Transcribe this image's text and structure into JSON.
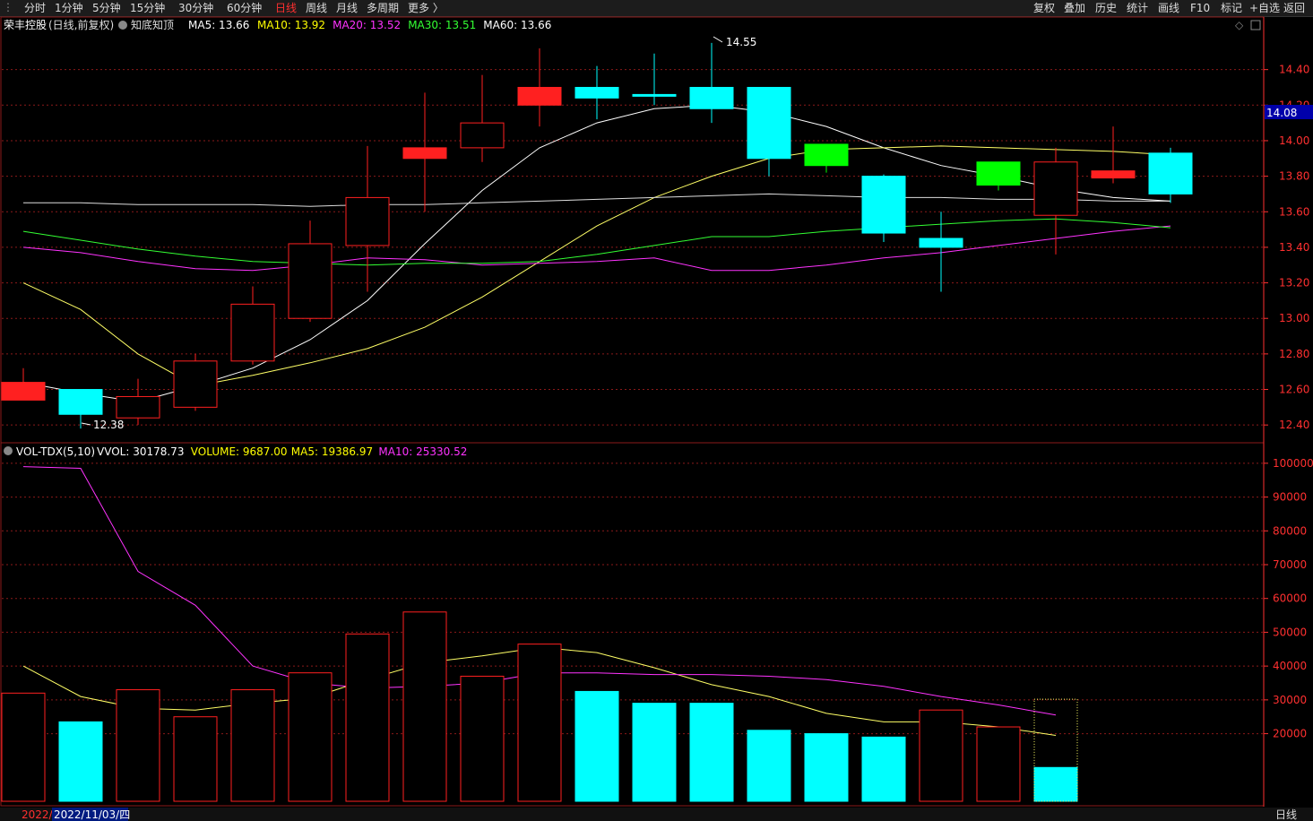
{
  "toolbar": {
    "left": [
      "分时",
      "1分钟",
      "5分钟",
      "15分钟",
      "30分钟",
      "60分钟",
      "日线",
      "周线",
      "月线",
      "多周期",
      "更多 〉"
    ],
    "active": "日线",
    "right": [
      "复权",
      "叠加",
      "历史",
      "统计",
      "画线",
      "F10",
      "标记",
      "+自选",
      "返回"
    ]
  },
  "colors": {
    "up": "#ff2020",
    "down": "#00ffff",
    "bear": "#00ff00",
    "ma5": "#ffffff",
    "ma10": "#ffff66",
    "ma20": "#ff33ff",
    "ma30": "#33ff33",
    "ma60": "#ffffff",
    "grid": "#8b1a1a",
    "axis": "#ff3030"
  },
  "price_panel": {
    "stock": "荣丰控股",
    "mode": "(日线,前复权)",
    "indicator": "知底知顶",
    "ma_labels": [
      {
        "text": "MA5: 13.66",
        "color": "#ffffff"
      },
      {
        "text": "MA10: 13.92",
        "color": "#ffff00"
      },
      {
        "text": "MA20: 13.52",
        "color": "#ff33ff"
      },
      {
        "text": "MA30: 13.51",
        "color": "#33ff33"
      },
      {
        "text": "MA60: 13.66",
        "color": "#ffffff"
      }
    ],
    "current_price": "14.08",
    "max_label": "14.55",
    "min_label": "12.38"
  },
  "volume_panel": {
    "title": "VOL-TDX(5,10)",
    "labels": [
      {
        "text": "VVOL: 30178.73",
        "color": "#ffffff"
      },
      {
        "text": "VOLUME: 9687.00",
        "color": "#ffff00"
      },
      {
        "text": "MA5: 19386.97",
        "color": "#ffff00"
      },
      {
        "text": "MA10: 25330.52",
        "color": "#ff33ff"
      }
    ]
  },
  "footer": {
    "date_prefix": "2022/",
    "date_selected": "2022/11/03/四",
    "period": "日线"
  },
  "chart_data": [
    {
      "type": "candlestick",
      "ylim": [
        12.3,
        14.6
      ],
      "yticks": [
        12.4,
        12.6,
        12.8,
        13.0,
        13.2,
        13.4,
        13.6,
        13.8,
        14.0,
        14.2,
        14.4
      ],
      "candles": [
        {
          "o": 12.64,
          "h": 12.72,
          "l": 12.54,
          "c": 12.54,
          "color": "up"
        },
        {
          "o": 12.6,
          "h": 12.6,
          "l": 12.38,
          "c": 12.46,
          "color": "down"
        },
        {
          "o": 12.56,
          "h": 12.66,
          "l": 12.4,
          "c": 12.44,
          "color": "up"
        },
        {
          "o": 12.5,
          "h": 12.8,
          "l": 12.48,
          "c": 12.76,
          "color": "up"
        },
        {
          "o": 12.76,
          "h": 13.18,
          "l": 12.74,
          "c": 13.08,
          "color": "up"
        },
        {
          "o": 13.0,
          "h": 13.55,
          "l": 12.98,
          "c": 13.42,
          "color": "up"
        },
        {
          "o": 13.41,
          "h": 13.97,
          "l": 13.15,
          "c": 13.68,
          "color": "up"
        },
        {
          "o": 13.9,
          "h": 14.27,
          "l": 13.6,
          "c": 13.96,
          "color": "up"
        },
        {
          "o": 13.96,
          "h": 14.37,
          "l": 13.88,
          "c": 14.1,
          "color": "up"
        },
        {
          "o": 14.2,
          "h": 14.52,
          "l": 14.08,
          "c": 14.3,
          "color": "up"
        },
        {
          "o": 14.3,
          "h": 14.42,
          "l": 14.12,
          "c": 14.24,
          "color": "down"
        },
        {
          "o": 14.26,
          "h": 14.49,
          "l": 14.2,
          "c": 14.26,
          "color": "down"
        },
        {
          "o": 14.3,
          "h": 14.55,
          "l": 14.1,
          "c": 14.18,
          "color": "down"
        },
        {
          "o": 14.3,
          "h": 14.3,
          "l": 13.8,
          "c": 13.9,
          "color": "down"
        },
        {
          "o": 13.98,
          "h": 13.98,
          "l": 13.82,
          "c": 13.86,
          "color": "bear"
        },
        {
          "o": 13.8,
          "h": 13.81,
          "l": 13.43,
          "c": 13.48,
          "color": "down"
        },
        {
          "o": 13.45,
          "h": 13.6,
          "l": 13.15,
          "c": 13.4,
          "color": "down"
        },
        {
          "o": 13.88,
          "h": 13.88,
          "l": 13.72,
          "c": 13.75,
          "color": "bear"
        },
        {
          "o": 13.58,
          "h": 13.96,
          "l": 13.36,
          "c": 13.88,
          "color": "up"
        },
        {
          "o": 13.79,
          "h": 14.08,
          "l": 13.76,
          "c": 13.83,
          "color": "up"
        },
        {
          "o": 13.93,
          "h": 13.96,
          "l": 13.65,
          "c": 13.7,
          "color": "down"
        }
      ],
      "ma_series": [
        {
          "name": "MA5",
          "color": "#ffffff",
          "values": [
            12.64,
            12.58,
            12.53,
            12.62,
            12.72,
            12.88,
            13.1,
            13.42,
            13.72,
            13.96,
            14.1,
            14.18,
            14.2,
            14.16,
            14.08,
            13.96,
            13.86,
            13.8,
            13.73,
            13.68,
            13.66
          ]
        },
        {
          "name": "MA10",
          "color": "#ffff66",
          "values": [
            13.2,
            13.05,
            12.8,
            12.62,
            12.68,
            12.75,
            12.83,
            12.95,
            13.12,
            13.32,
            13.52,
            13.68,
            13.8,
            13.9,
            13.95,
            13.96,
            13.97,
            13.96,
            13.95,
            13.94,
            13.92
          ]
        },
        {
          "name": "MA20",
          "color": "#ff33ff",
          "values": [
            13.4,
            13.37,
            13.32,
            13.28,
            13.27,
            13.3,
            13.34,
            13.33,
            13.3,
            13.31,
            13.32,
            13.34,
            13.27,
            13.27,
            13.3,
            13.34,
            13.37,
            13.41,
            13.45,
            13.49,
            13.52
          ]
        },
        {
          "name": "MA30",
          "color": "#33ff33",
          "values": [
            13.49,
            13.44,
            13.39,
            13.35,
            13.32,
            13.31,
            13.3,
            13.31,
            13.31,
            13.32,
            13.36,
            13.41,
            13.46,
            13.46,
            13.49,
            13.51,
            13.53,
            13.55,
            13.56,
            13.54,
            13.51
          ]
        },
        {
          "name": "MA60",
          "color": "#dddddd",
          "values": [
            13.65,
            13.65,
            13.64,
            13.64,
            13.64,
            13.63,
            13.64,
            13.64,
            13.65,
            13.66,
            13.67,
            13.68,
            13.69,
            13.7,
            13.69,
            13.68,
            13.68,
            13.67,
            13.67,
            13.66,
            13.66
          ]
        }
      ]
    },
    {
      "type": "bar",
      "ylim": [
        0,
        105000
      ],
      "yticks": [
        20000,
        30000,
        40000,
        50000,
        60000,
        70000,
        80000,
        90000,
        100000
      ],
      "volumes": [
        32000,
        23500,
        33000,
        25000,
        33000,
        38000,
        49500,
        56000,
        37000,
        46500,
        32500,
        29000,
        29000,
        21000,
        20000,
        19000,
        27000,
        22000,
        10000
      ],
      "volume_colors": [
        "up",
        "down",
        "up",
        "up",
        "up",
        "up",
        "up",
        "up",
        "up",
        "up",
        "down",
        "down",
        "down",
        "down",
        "down",
        "down",
        "up",
        "up",
        "down"
      ],
      "vvol": 30178.73,
      "ma5": [
        40000,
        31000,
        27500,
        27000,
        29000,
        30500,
        36000,
        41000,
        43000,
        45500,
        44000,
        39500,
        34500,
        31000,
        26000,
        23500,
        23500,
        22000,
        19500
      ],
      "ma10": [
        99000,
        98500,
        68000,
        58000,
        40000,
        35000,
        33500,
        34000,
        35000,
        38000,
        38000,
        37500,
        37500,
        37000,
        36000,
        34000,
        31000,
        28500,
        25500
      ]
    }
  ]
}
